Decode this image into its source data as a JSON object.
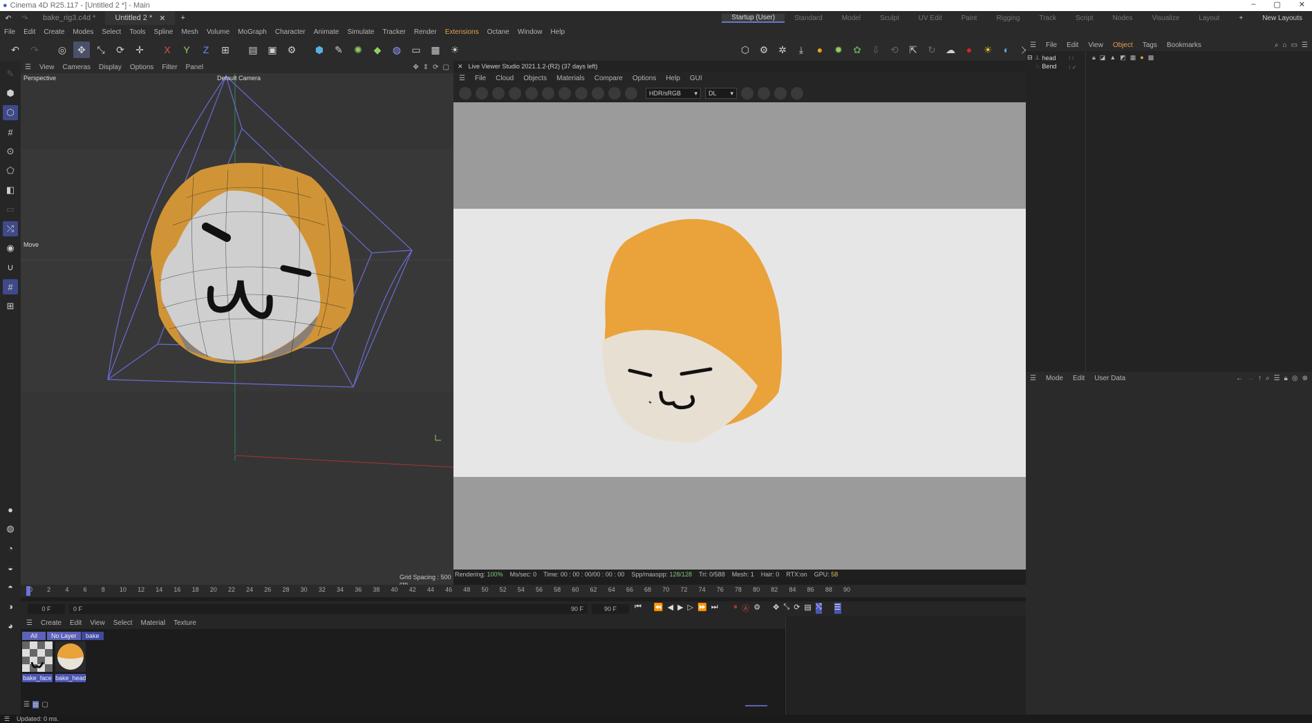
{
  "window": {
    "title": "Cinema 4D R25.117 - [Untitled 2 *] - Main"
  },
  "tabs": [
    {
      "label": "bake_rig3.c4d *"
    },
    {
      "label": "Untitled 2 *"
    }
  ],
  "layouts": [
    "Startup (User)",
    "Standard",
    "Model",
    "Sculpt",
    "UV Edit",
    "Paint",
    "Rigging",
    "Track",
    "Script",
    "Nodes",
    "Visualize",
    "Layout"
  ],
  "new_layouts": "New Layouts",
  "menu": [
    "File",
    "Edit",
    "Create",
    "Modes",
    "Select",
    "Tools",
    "Spline",
    "Mesh",
    "Volume",
    "MoGraph",
    "Character",
    "Animate",
    "Simulate",
    "Tracker",
    "Render",
    "Extensions",
    "Octane",
    "Window",
    "Help"
  ],
  "viewport": {
    "menu": [
      "View",
      "Cameras",
      "Display",
      "Options",
      "Filter",
      "Panel"
    ],
    "label": "Perspective",
    "camera": "Default Camera",
    "tool": "Move",
    "grid": "Grid Spacing : 500 cm"
  },
  "liveviewer": {
    "title": "Live Viewer Studio 2021.1.2-(R2) (37 days left)",
    "menu": [
      "File",
      "Cloud",
      "Objects",
      "Materials",
      "Compare",
      "Options",
      "Help",
      "GUI"
    ],
    "color_space": "HDR/sRGB",
    "kernel": "DL",
    "status": {
      "rendering_label": "Rendering:",
      "rendering": "100%",
      "ms_label": "Ms/sec:",
      "ms": "0",
      "time_label": "Time:",
      "time": "00 : 00 : 00/00 : 00 : 00",
      "spp_label": "Spp/maxspp:",
      "spp": "128/128",
      "tri_label": "Tri:",
      "tri": "0/588",
      "mesh_label": "Mesh:",
      "mesh": "1",
      "hair_label": "Hair:",
      "hair": "0",
      "rtx_label": "RTX:",
      "rtx": "on",
      "gpu_label": "GPU:",
      "gpu": "58"
    }
  },
  "timeline": {
    "ticks": [
      "0",
      "2",
      "4",
      "6",
      "8",
      "10",
      "12",
      "14",
      "16",
      "18",
      "20",
      "22",
      "24",
      "26",
      "28",
      "30",
      "32",
      "34",
      "36",
      "38",
      "40",
      "42",
      "44",
      "46",
      "48",
      "50",
      "52",
      "54",
      "56",
      "58",
      "60",
      "62",
      "64",
      "66",
      "68",
      "70",
      "72",
      "74",
      "76",
      "78",
      "80",
      "82",
      "84",
      "86",
      "88",
      "90"
    ],
    "current": "0 F",
    "start": "0 F",
    "end": "90 F",
    "max": "90 F"
  },
  "materials": {
    "menu": [
      "Create",
      "Edit",
      "View",
      "Select",
      "Material",
      "Texture"
    ],
    "filters": [
      "All",
      "No Layer",
      "bake"
    ],
    "items": [
      {
        "name": "bake_face"
      },
      {
        "name": "bake_head"
      }
    ]
  },
  "object_manager": {
    "menu": [
      "File",
      "Edit",
      "View",
      "Object",
      "Tags",
      "Bookmarks"
    ],
    "objects": [
      {
        "name": "head"
      },
      {
        "name": "Bend"
      }
    ]
  },
  "attributes": {
    "menu": [
      "Mode",
      "Edit",
      "User Data"
    ]
  },
  "status": "Updated: 0 ms.",
  "colors": {
    "accent": "#5c63b8",
    "orange": "#e0a050",
    "hair": "#d99a3a",
    "face": "#e8e3da"
  }
}
